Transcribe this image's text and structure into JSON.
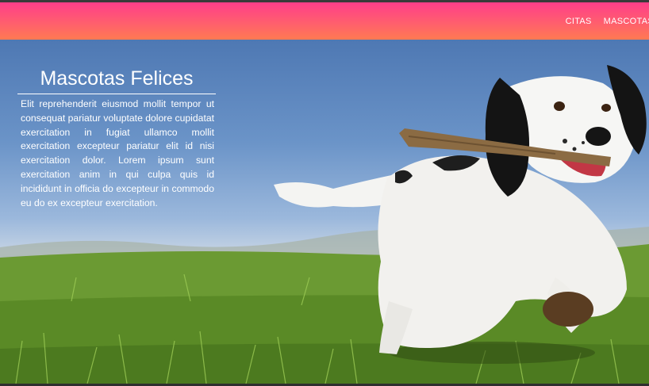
{
  "navbar": {
    "links": [
      {
        "label": "CITAS"
      },
      {
        "label": "MASCOTAS"
      }
    ]
  },
  "hero": {
    "image_description_name": "dog-running-with-stick-photo",
    "info": {
      "title": "Mascotas Felices",
      "text": "Elit reprehenderit eiusmod mollit tempor ut consequat pariatur voluptate dolore cupidatat exercitation in fugiat ullamco mollit exercitation excepteur pariatur elit id nisi exercitation dolor. Lorem ipsum sunt exercitation anim in qui culpa quis id incididunt in officia do excepteur in commodo eu do ex excepteur exercitation."
    }
  },
  "colors": {
    "nav_gradient_start": "#ff3e8a",
    "nav_gradient_end": "#ff7a52",
    "text": "#ffffff"
  }
}
